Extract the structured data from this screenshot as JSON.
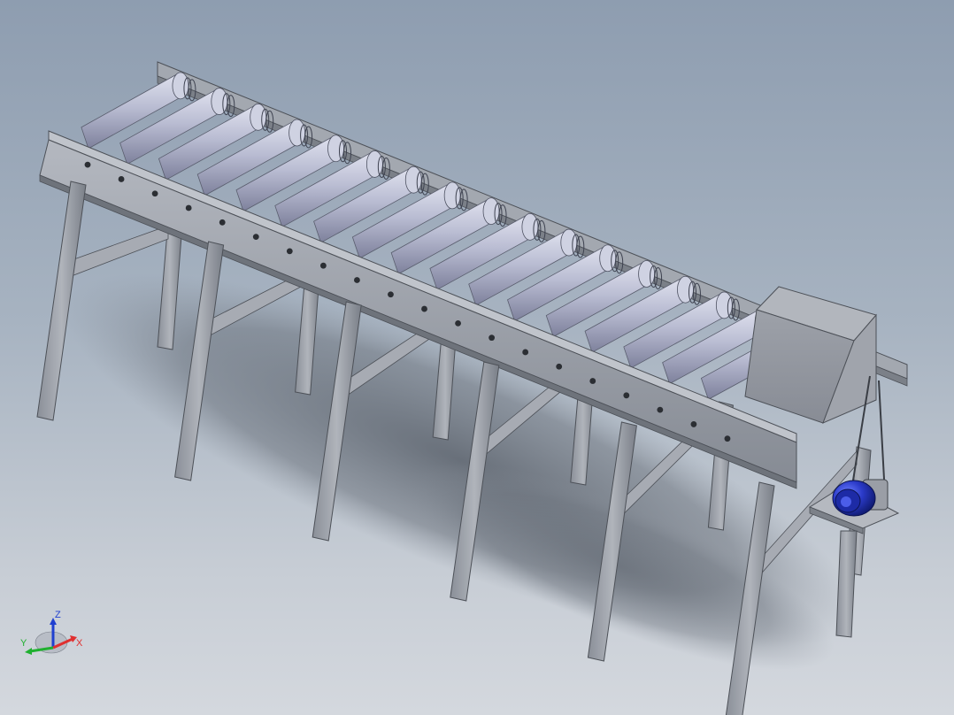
{
  "viewport": {
    "kind": "3d-cad-model-view",
    "background_top": "#8e9db0",
    "background_bottom": "#d4d8de"
  },
  "model": {
    "component": "roller-conveyor",
    "roller_count": 17,
    "leg_pairs": 6,
    "colors": {
      "frame": "#9ea3ab",
      "frame_shade": "#6e737b",
      "roller": "#c3c6d8",
      "roller_shade": "#8d90a8",
      "motor": "#2a3ac8",
      "gearbox": "#9a9ea6",
      "shadow": "#5f6670"
    }
  },
  "triad": {
    "x_label": "X",
    "y_label": "Y",
    "z_label": "Z",
    "x_color": "#e03030",
    "y_color": "#20b030",
    "z_color": "#2040d0"
  }
}
